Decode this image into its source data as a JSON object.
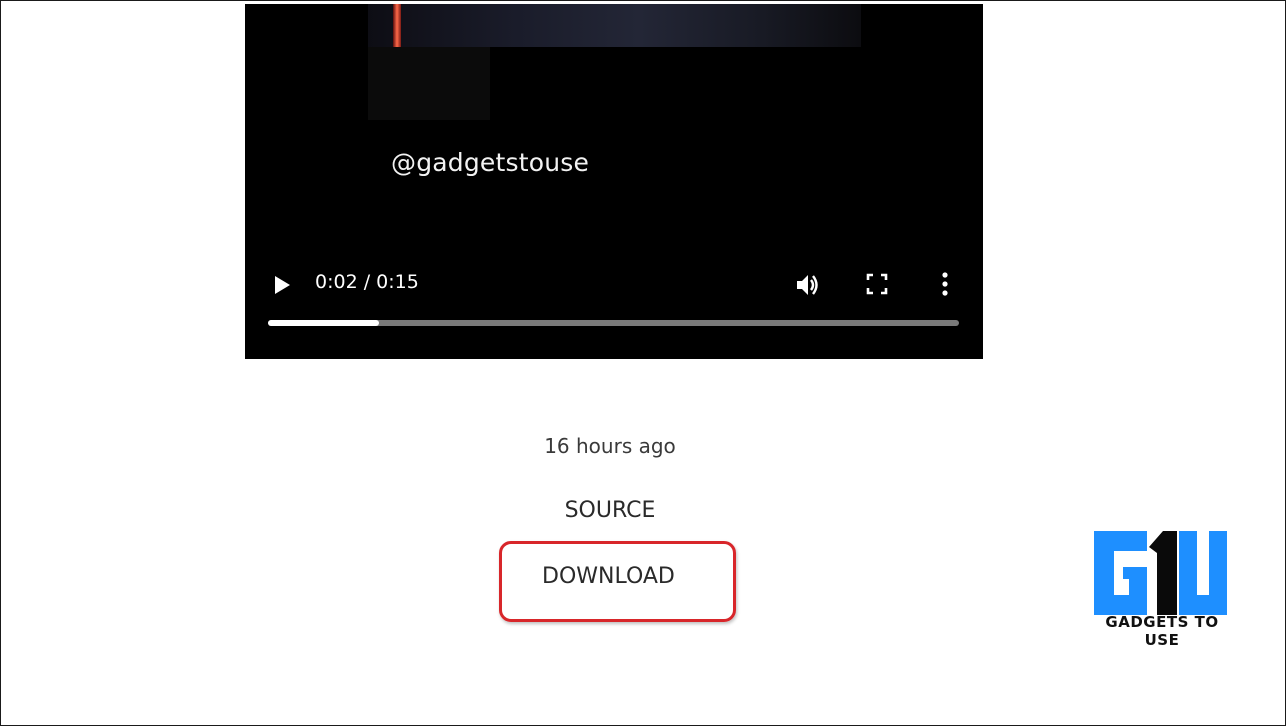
{
  "video": {
    "overlay_text": "@gadgetstouse",
    "time_display": "0:02 / 0:15",
    "progress_fraction": 0.16,
    "icons": {
      "play": "play-icon",
      "volume": "volume-icon",
      "fullscreen": "fullscreen-icon",
      "more": "more-options-icon"
    }
  },
  "post": {
    "timestamp": "16 hours ago",
    "source_label": "SOURCE",
    "download_label": "DOWNLOAD"
  },
  "annotation": {
    "highlight_color": "#d8262a"
  },
  "logo": {
    "caption": "GADGETS TO USE",
    "brand_color": "#1e8fff",
    "mark": "GTU"
  }
}
